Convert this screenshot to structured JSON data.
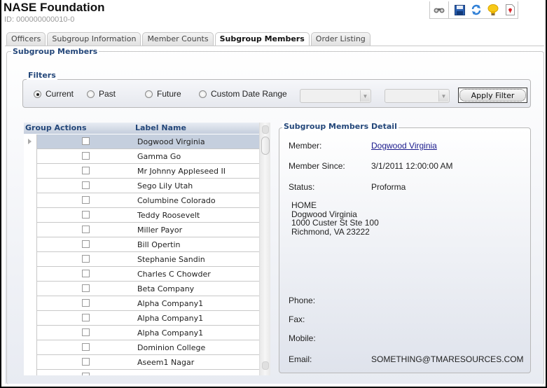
{
  "header": {
    "title": "NASE Foundation",
    "id_label": "ID: 000000000010-0"
  },
  "toolbar": {
    "buttons": [
      {
        "name": "binoculars-icon",
        "glyph": "⚯"
      },
      {
        "name": "save-icon",
        "glyph": "💾"
      },
      {
        "name": "refresh-icon",
        "glyph": "↻"
      },
      {
        "name": "lightbulb-icon",
        "glyph": "💡"
      },
      {
        "name": "report-icon",
        "glyph": "📄"
      }
    ]
  },
  "tabs": [
    {
      "label": "Officers",
      "active": false
    },
    {
      "label": "Subgroup Information",
      "active": false
    },
    {
      "label": "Member Counts",
      "active": false
    },
    {
      "label": "Subgroup Members",
      "active": true
    },
    {
      "label": "Order Listing",
      "active": false
    }
  ],
  "section": {
    "title": "Subgroup Members"
  },
  "filters": {
    "title": "Filters",
    "options": [
      {
        "label": "Current",
        "selected": true
      },
      {
        "label": "Past",
        "selected": false
      },
      {
        "label": "Future",
        "selected": false
      },
      {
        "label": "Custom Date Range",
        "selected": false
      }
    ],
    "start_date": "",
    "end_date": "",
    "apply_label": "Apply Filter"
  },
  "grid": {
    "columns": [
      "Group Actions",
      "Label Name"
    ],
    "rows": [
      {
        "name": "Dogwood Virginia",
        "checked": false,
        "selected": true
      },
      {
        "name": "Gamma Go",
        "checked": false,
        "selected": false
      },
      {
        "name": "Mr Johnny Appleseed II",
        "checked": false,
        "selected": false
      },
      {
        "name": "Sego Lily Utah",
        "checked": false,
        "selected": false
      },
      {
        "name": "Columbine Colorado",
        "checked": false,
        "selected": false
      },
      {
        "name": "Teddy Roosevelt",
        "checked": false,
        "selected": false
      },
      {
        "name": "Miller Payor",
        "checked": false,
        "selected": false
      },
      {
        "name": "Bill Opertin",
        "checked": false,
        "selected": false
      },
      {
        "name": "Stephanie Sandin",
        "checked": false,
        "selected": false
      },
      {
        "name": "Charles C Chowder",
        "checked": false,
        "selected": false
      },
      {
        "name": "Beta Company",
        "checked": false,
        "selected": false
      },
      {
        "name": "Alpha Company1",
        "checked": false,
        "selected": false
      },
      {
        "name": "Alpha Company1",
        "checked": false,
        "selected": false
      },
      {
        "name": "Alpha Company1",
        "checked": false,
        "selected": false
      },
      {
        "name": "Dominion College",
        "checked": false,
        "selected": false
      },
      {
        "name": "Aseem1 Nagar",
        "checked": false,
        "selected": false
      },
      {
        "name": "",
        "checked": false,
        "selected": false
      }
    ]
  },
  "detail": {
    "title": "Subgroup Members Detail",
    "member_label": "Member:",
    "member_value": "Dogwood Virginia",
    "since_label": "Member Since:",
    "since_value": "3/1/2011 12:00:00 AM",
    "status_label": "Status:",
    "status_value": "Proforma",
    "address": [
      "HOME",
      "Dogwood Virginia",
      "1000 Custer St Ste 100",
      "Richmond, VA 23222"
    ],
    "phone_label": "Phone:",
    "phone_value": "",
    "fax_label": "Fax:",
    "fax_value": "",
    "mobile_label": "Mobile:",
    "mobile_value": "",
    "email_label": "Email:",
    "email_value": "SOMETHING@TMARESOURCES.COM"
  },
  "colors": {
    "accent_text": "#24477a",
    "selected_row": "#c5cfde",
    "link": "#1a1a8c"
  }
}
